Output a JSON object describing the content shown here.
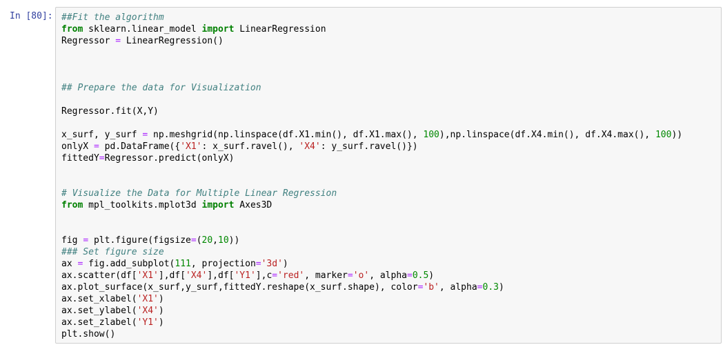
{
  "cell": {
    "prompt": "In [80]:",
    "lines": [
      [
        {
          "t": "##Fit the algorithm",
          "k": "comment"
        }
      ],
      [
        {
          "t": "from",
          "k": "kw"
        },
        {
          "t": " sklearn.linear_model ",
          "k": ""
        },
        {
          "t": "import",
          "k": "kw"
        },
        {
          "t": " LinearRegression",
          "k": ""
        }
      ],
      [
        {
          "t": "Regressor ",
          "k": ""
        },
        {
          "t": "=",
          "k": "op"
        },
        {
          "t": " LinearRegression()",
          "k": ""
        }
      ],
      [],
      [],
      [],
      [
        {
          "t": "## Prepare the data for Visualization",
          "k": "comment"
        }
      ],
      [],
      [
        {
          "t": "Regressor.fit(X,Y)",
          "k": ""
        }
      ],
      [],
      [
        {
          "t": "x_surf, y_surf ",
          "k": ""
        },
        {
          "t": "=",
          "k": "op"
        },
        {
          "t": " np.meshgrid(np.linspace(df.X1.min(), df.X1.max(), ",
          "k": ""
        },
        {
          "t": "100",
          "k": "num"
        },
        {
          "t": "),np.linspace(df.X4.min(), df.X4.max(), ",
          "k": ""
        },
        {
          "t": "100",
          "k": "num"
        },
        {
          "t": "))",
          "k": ""
        }
      ],
      [
        {
          "t": "onlyX ",
          "k": ""
        },
        {
          "t": "=",
          "k": "op"
        },
        {
          "t": " pd.DataFrame({",
          "k": ""
        },
        {
          "t": "'X1'",
          "k": "str"
        },
        {
          "t": ": x_surf.ravel(), ",
          "k": ""
        },
        {
          "t": "'X4'",
          "k": "str"
        },
        {
          "t": ": y_surf.ravel()})",
          "k": ""
        }
      ],
      [
        {
          "t": "fittedY",
          "k": ""
        },
        {
          "t": "=",
          "k": "op"
        },
        {
          "t": "Regressor.predict(onlyX)",
          "k": ""
        }
      ],
      [],
      [],
      [
        {
          "t": "# Visualize the Data for Multiple Linear Regression",
          "k": "comment"
        }
      ],
      [
        {
          "t": "from",
          "k": "kw"
        },
        {
          "t": " mpl_toolkits.mplot3d ",
          "k": ""
        },
        {
          "t": "import",
          "k": "kw"
        },
        {
          "t": " Axes3D",
          "k": ""
        }
      ],
      [],
      [],
      [
        {
          "t": "fig ",
          "k": ""
        },
        {
          "t": "=",
          "k": "op"
        },
        {
          "t": " plt.figure(figsize",
          "k": ""
        },
        {
          "t": "=",
          "k": "op"
        },
        {
          "t": "(",
          "k": ""
        },
        {
          "t": "20",
          "k": "num"
        },
        {
          "t": ",",
          "k": ""
        },
        {
          "t": "10",
          "k": "num"
        },
        {
          "t": "))",
          "k": ""
        }
      ],
      [
        {
          "t": "### Set figure size",
          "k": "comment"
        }
      ],
      [
        {
          "t": "ax ",
          "k": ""
        },
        {
          "t": "=",
          "k": "op"
        },
        {
          "t": " fig.add_subplot(",
          "k": ""
        },
        {
          "t": "111",
          "k": "num"
        },
        {
          "t": ", projection",
          "k": ""
        },
        {
          "t": "=",
          "k": "op"
        },
        {
          "t": "'3d'",
          "k": "str"
        },
        {
          "t": ")",
          "k": ""
        }
      ],
      [
        {
          "t": "ax.scatter(df[",
          "k": ""
        },
        {
          "t": "'X1'",
          "k": "str"
        },
        {
          "t": "],df[",
          "k": ""
        },
        {
          "t": "'X4'",
          "k": "str"
        },
        {
          "t": "],df[",
          "k": ""
        },
        {
          "t": "'Y1'",
          "k": "str"
        },
        {
          "t": "],c",
          "k": ""
        },
        {
          "t": "=",
          "k": "op"
        },
        {
          "t": "'red'",
          "k": "str"
        },
        {
          "t": ", marker",
          "k": ""
        },
        {
          "t": "=",
          "k": "op"
        },
        {
          "t": "'o'",
          "k": "str"
        },
        {
          "t": ", alpha",
          "k": ""
        },
        {
          "t": "=",
          "k": "op"
        },
        {
          "t": "0.5",
          "k": "num"
        },
        {
          "t": ")",
          "k": ""
        }
      ],
      [
        {
          "t": "ax.plot_surface(x_surf,y_surf,fittedY.reshape(x_surf.shape), color",
          "k": ""
        },
        {
          "t": "=",
          "k": "op"
        },
        {
          "t": "'b'",
          "k": "str"
        },
        {
          "t": ", alpha",
          "k": ""
        },
        {
          "t": "=",
          "k": "op"
        },
        {
          "t": "0.3",
          "k": "num"
        },
        {
          "t": ")",
          "k": ""
        }
      ],
      [
        {
          "t": "ax.set_xlabel(",
          "k": ""
        },
        {
          "t": "'X1'",
          "k": "str"
        },
        {
          "t": ")",
          "k": ""
        }
      ],
      [
        {
          "t": "ax.set_ylabel(",
          "k": ""
        },
        {
          "t": "'X4'",
          "k": "str"
        },
        {
          "t": ")",
          "k": ""
        }
      ],
      [
        {
          "t": "ax.set_zlabel(",
          "k": ""
        },
        {
          "t": "'Y1'",
          "k": "str"
        },
        {
          "t": ")",
          "k": ""
        }
      ],
      [
        {
          "t": "plt.show()",
          "k": ""
        }
      ]
    ]
  }
}
